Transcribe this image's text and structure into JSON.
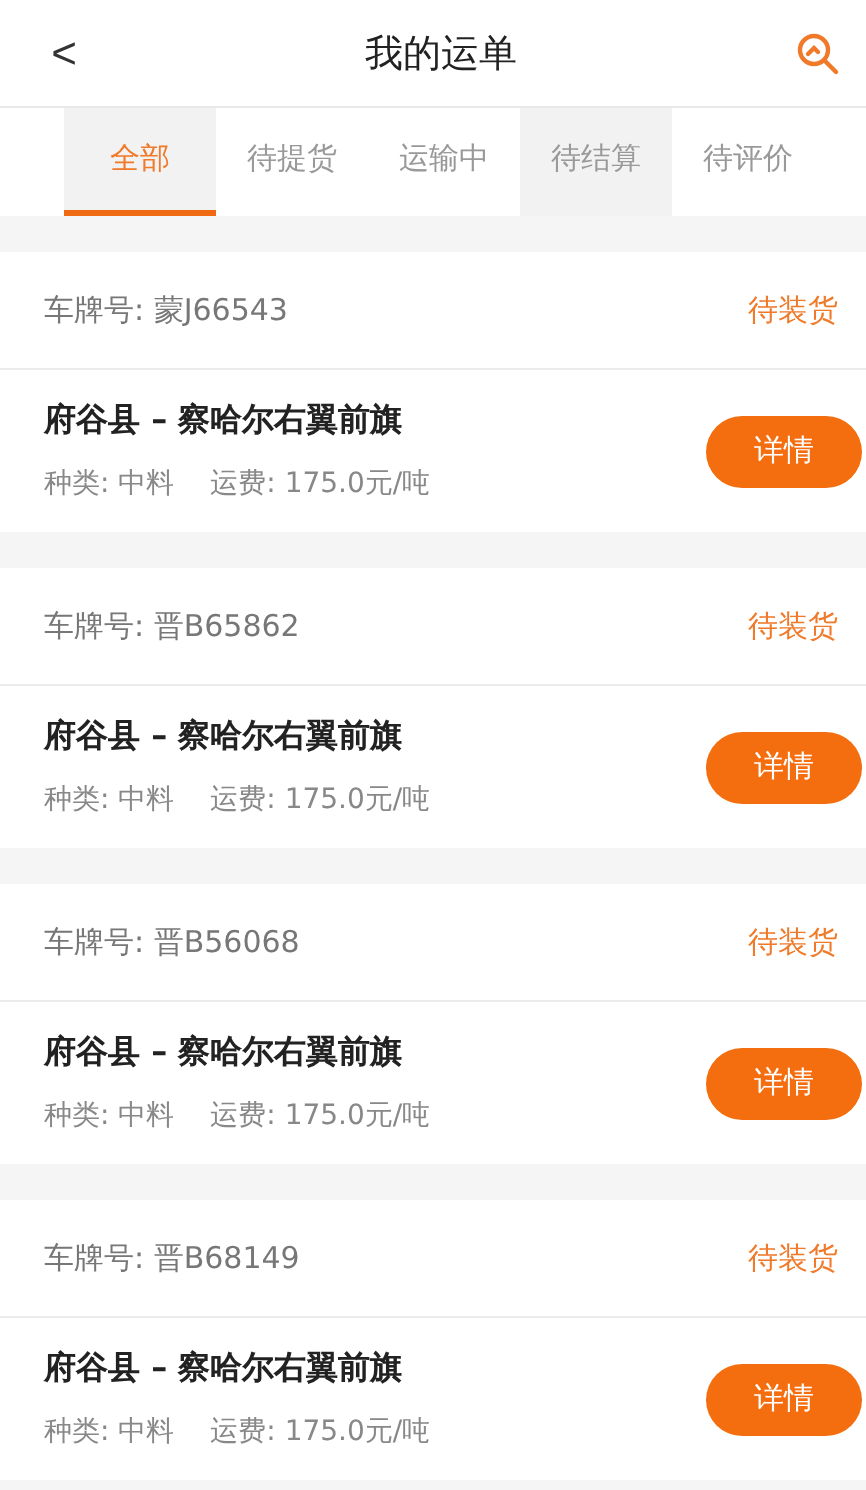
{
  "header": {
    "back": "<",
    "title": "我的运单"
  },
  "tabs": [
    {
      "label": "全部",
      "selected": true,
      "pressed": false
    },
    {
      "label": "待提货",
      "selected": false,
      "pressed": false
    },
    {
      "label": "运输中",
      "selected": false,
      "pressed": false
    },
    {
      "label": "待结算",
      "selected": false,
      "pressed": true
    },
    {
      "label": "待评价",
      "selected": false,
      "pressed": false
    }
  ],
  "orders": [
    {
      "plate": "车牌号: 蒙J66543",
      "status": "待装货",
      "route": "府谷县 – 察哈尔右翼前旗",
      "category": "种类: 中料",
      "freight": "运费: 175.0元/吨",
      "button": "详情"
    },
    {
      "plate": "车牌号: 晋B65862",
      "status": "待装货",
      "route": "府谷县 – 察哈尔右翼前旗",
      "category": "种类: 中料",
      "freight": "运费: 175.0元/吨",
      "button": "详情"
    },
    {
      "plate": "车牌号: 晋B56068",
      "status": "待装货",
      "route": "府谷县 – 察哈尔右翼前旗",
      "category": "种类: 中料",
      "freight": "运费: 175.0元/吨",
      "button": "详情"
    },
    {
      "plate": "车牌号: 晋B68149",
      "status": "待装货",
      "route": "府谷县 – 察哈尔右翼前旗",
      "category": "种类: 中料",
      "freight": "运费: 175.0元/吨",
      "button": "详情"
    }
  ]
}
